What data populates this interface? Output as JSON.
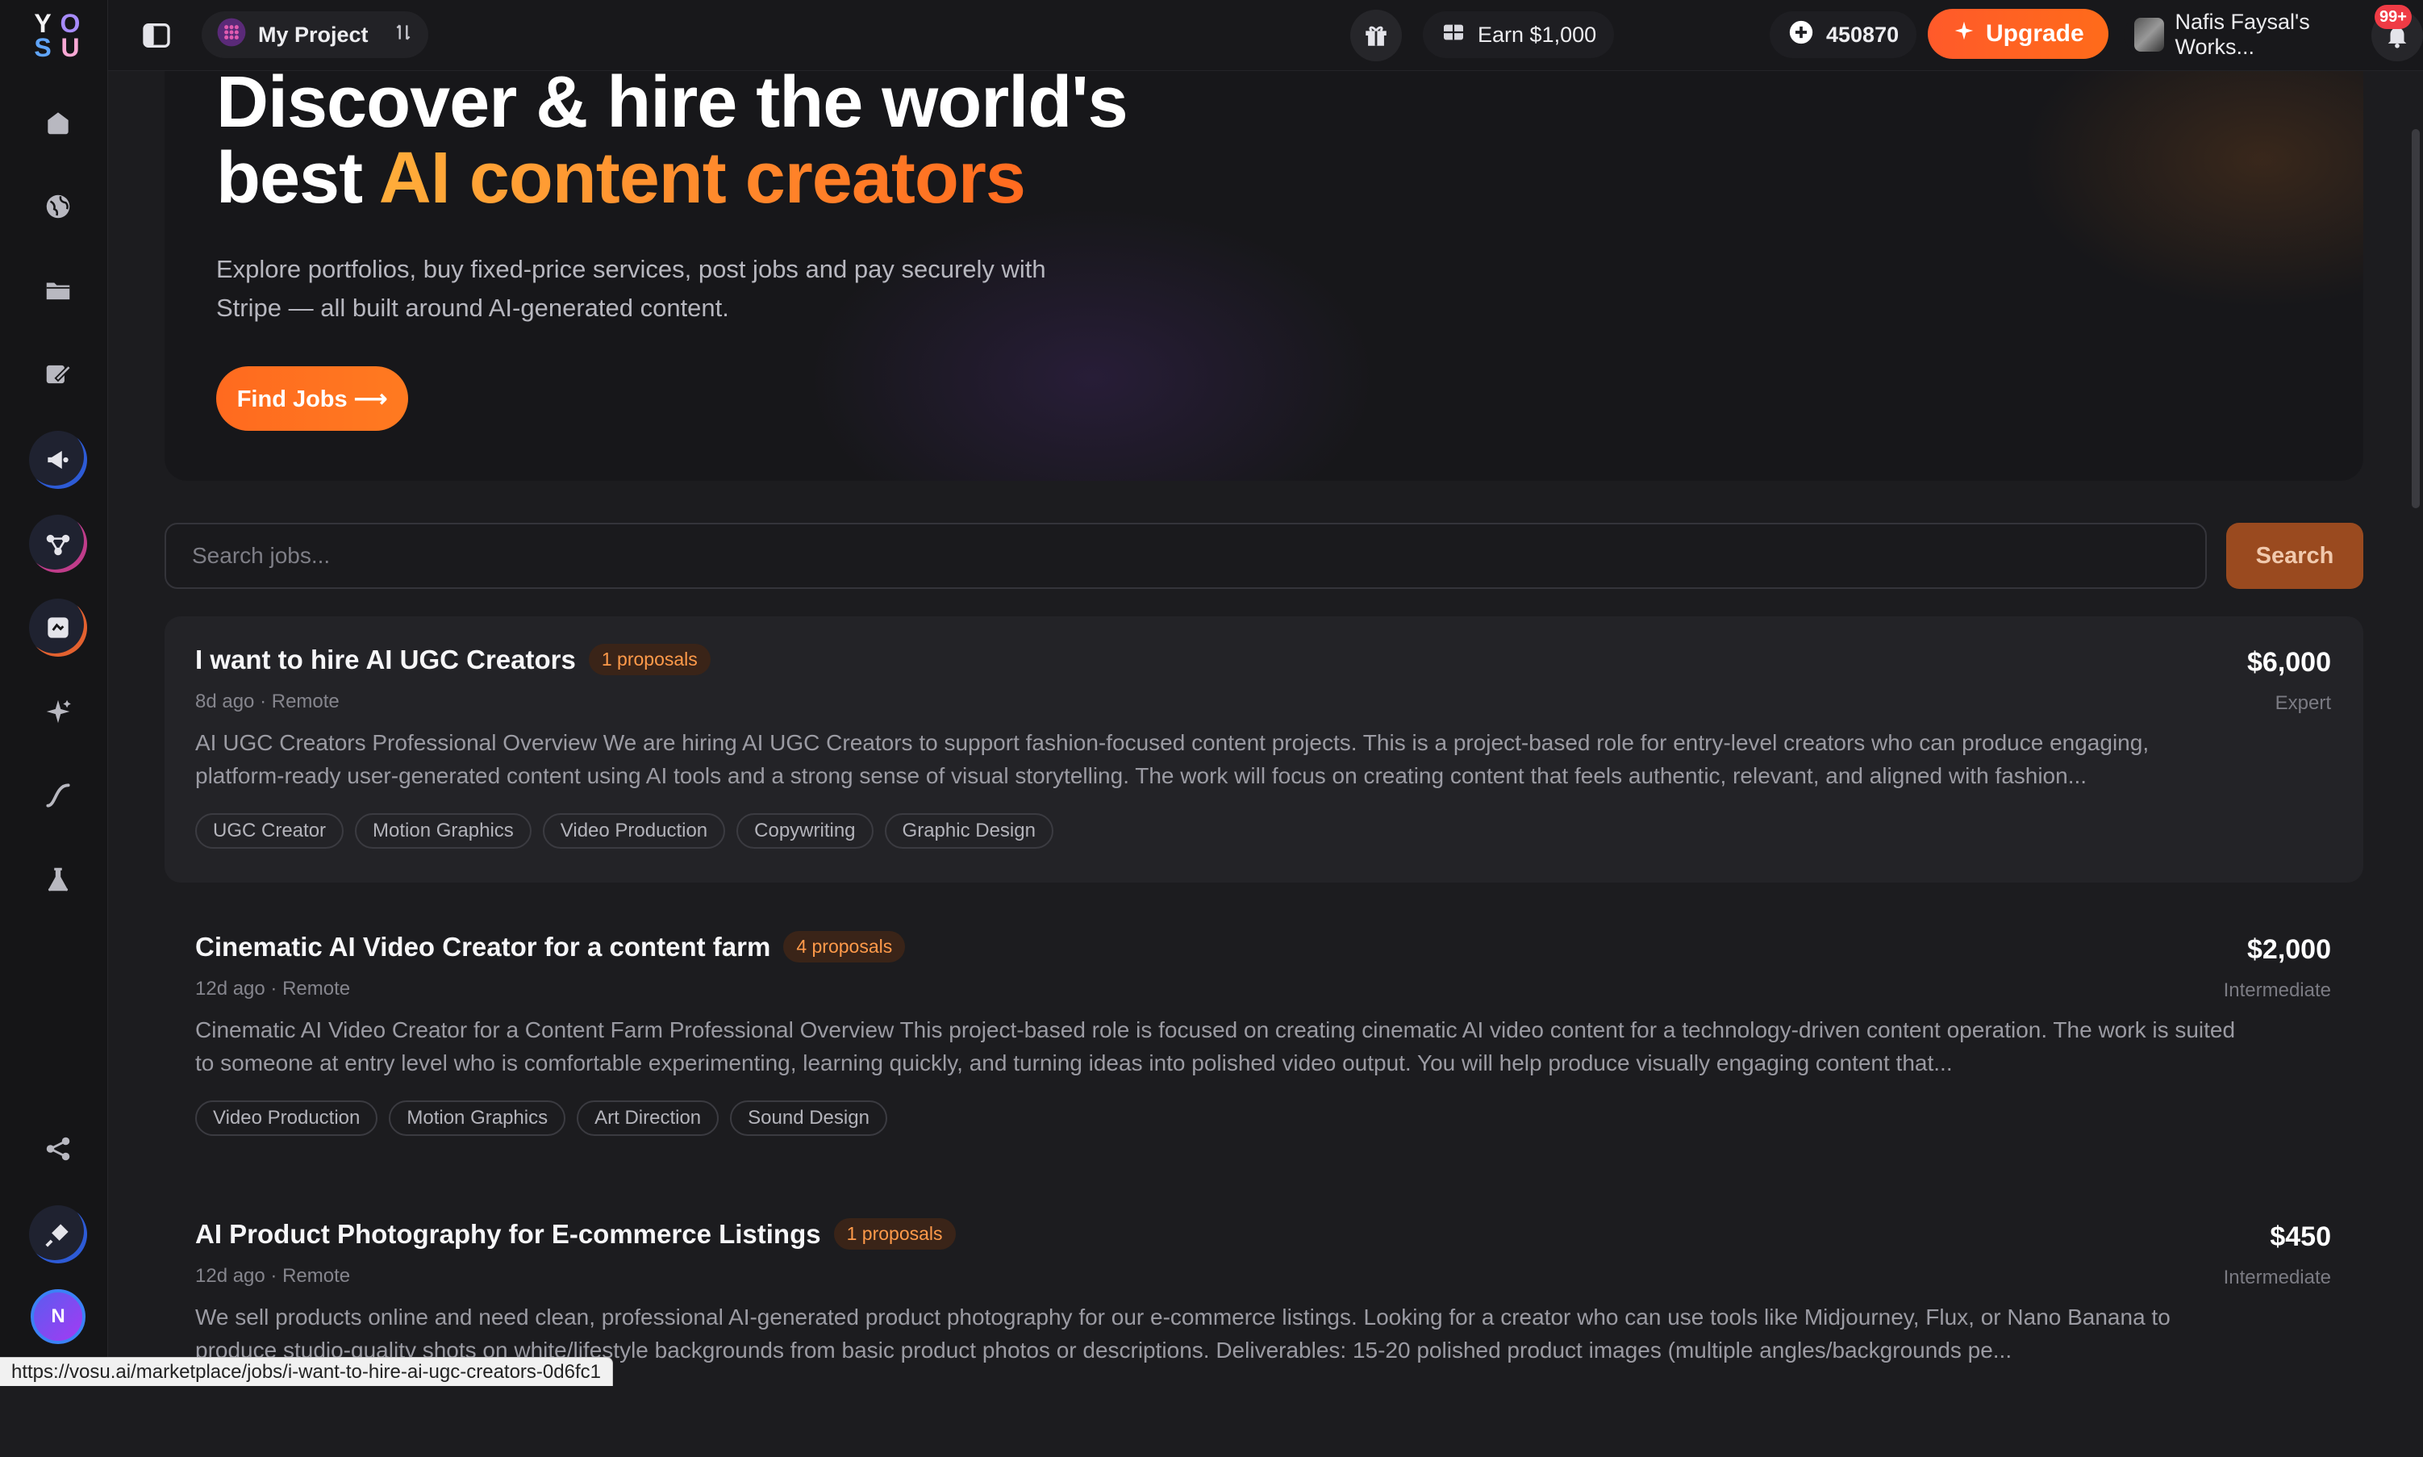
{
  "topbar": {
    "project_name": "My Project",
    "earn_label": "Earn $1,000",
    "credits": "450870",
    "upgrade_label": "Upgrade",
    "workspace_name": "Nafis Faysal's Works...",
    "notifications_badge": "99+"
  },
  "sidebar": {
    "logo": [
      "Y",
      "O",
      "S",
      "U"
    ],
    "avatar_initial": "N"
  },
  "hero": {
    "title_line1": "Discover & hire the world's",
    "title_line2_plain": "best ",
    "title_line2_accent": "AI content creators",
    "subtitle": "Explore portfolios, buy fixed-price services, post jobs and pay securely with Stripe — all built around AI-generated content.",
    "cta_label": "Find Jobs ⟶"
  },
  "search": {
    "placeholder": "Search jobs...",
    "button_label": "Search"
  },
  "jobs": [
    {
      "title": "I want to hire AI UGC Creators",
      "proposals": "1 proposals",
      "meta": "8d ago · Remote",
      "description": "AI UGC Creators Professional Overview We are hiring AI UGC Creators to support fashion-focused content projects. This is a project-based role for entry-level creators who can produce engaging, platform-ready user-generated content using AI tools and a strong sense of visual storytelling. The work will focus on creating content that feels authentic, relevant, and aligned with fashion...",
      "tags": [
        "UGC Creator",
        "Motion Graphics",
        "Video Production",
        "Copywriting",
        "Graphic Design"
      ],
      "price": "$6,000",
      "level": "Expert"
    },
    {
      "title": "Cinematic AI Video Creator for a content farm",
      "proposals": "4 proposals",
      "meta": "12d ago · Remote",
      "description": "Cinematic AI Video Creator for a Content Farm Professional Overview This project-based role is focused on creating cinematic AI video content for a technology-driven content operation. The work is suited to someone at entry level who is comfortable experimenting, learning quickly, and turning ideas into polished video output. You will help produce visually engaging content that...",
      "tags": [
        "Video Production",
        "Motion Graphics",
        "Art Direction",
        "Sound Design"
      ],
      "price": "$2,000",
      "level": "Intermediate"
    },
    {
      "title": "AI Product Photography for E-commerce Listings",
      "proposals": "1 proposals",
      "meta": "12d ago · Remote",
      "description": "We sell products online and need clean, professional AI-generated product photography for our e-commerce listings. Looking for a creator who can use tools like Midjourney, Flux, or Nano Banana to produce studio-quality shots on white/lifestyle backgrounds from basic product photos or descriptions. Deliverables: 15-20 polished product images (multiple angles/backgrounds pe...",
      "tags": [],
      "price": "$450",
      "level": "Intermediate"
    }
  ],
  "statusbar": {
    "url": "https://vosu.ai/marketplace/jobs/i-want-to-hire-ai-ugc-creators-0d6fc1"
  },
  "colors": {
    "accent": "#ff6a1f",
    "background": "#1c1c1f",
    "card_highlight": "#232327"
  }
}
